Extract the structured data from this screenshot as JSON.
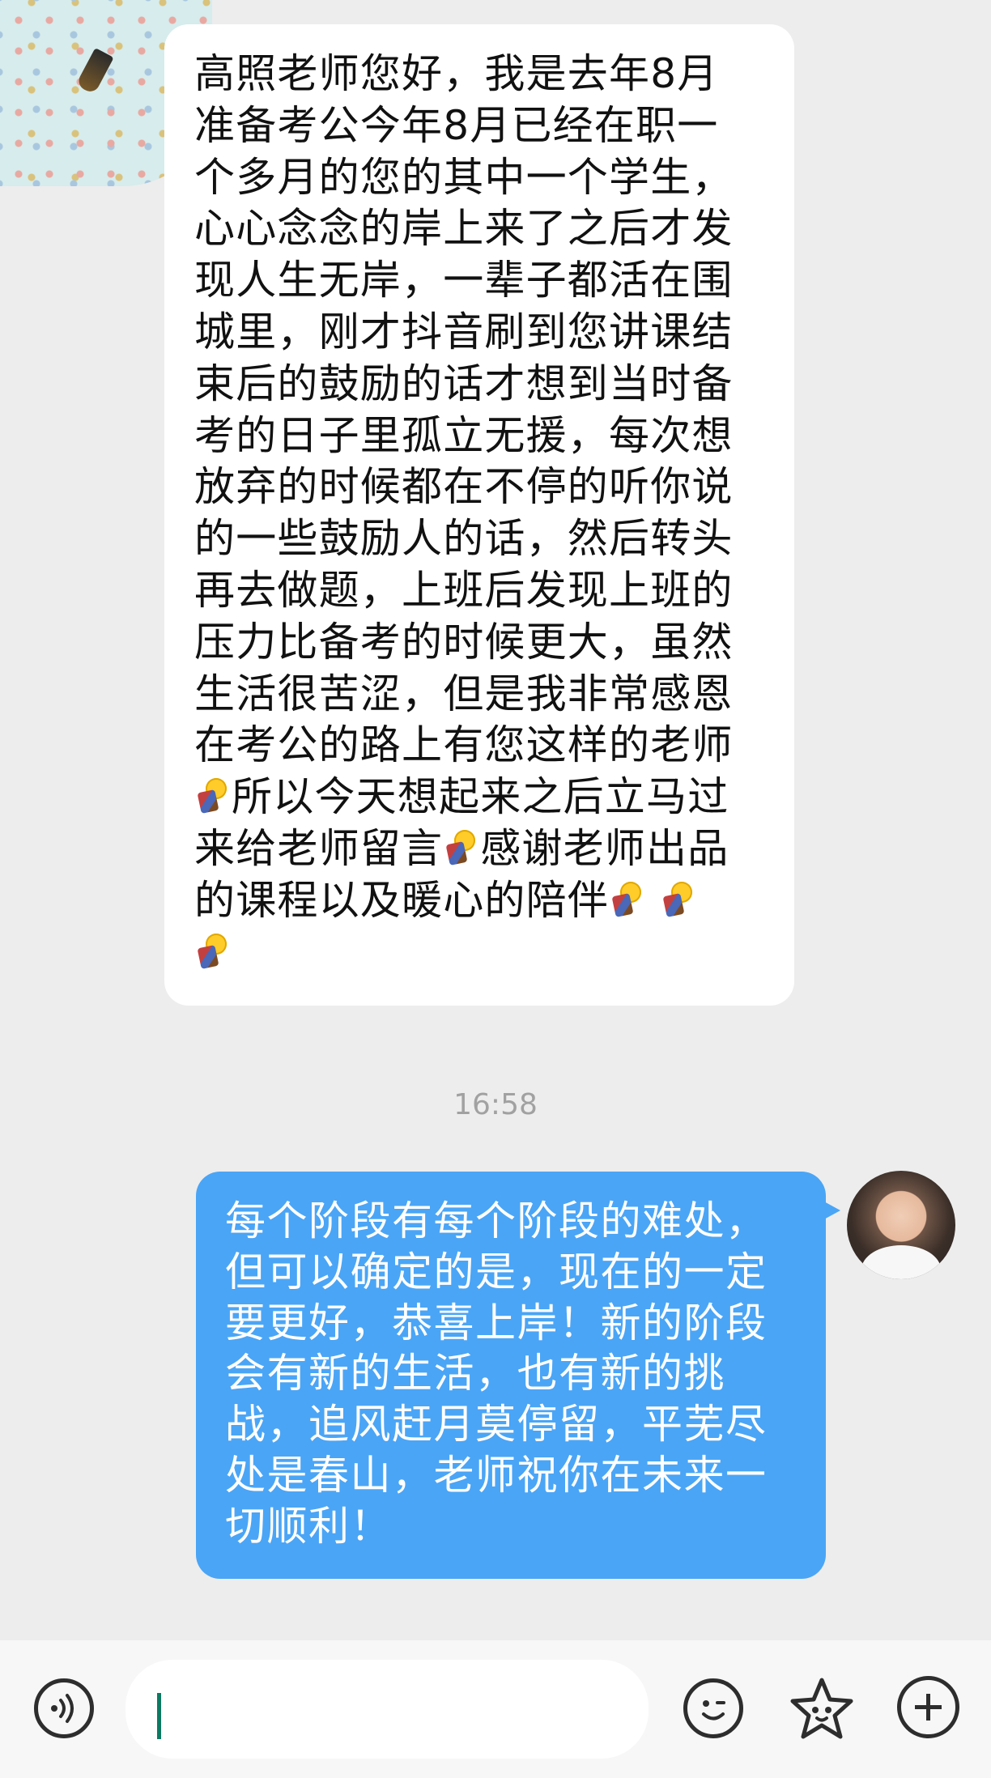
{
  "chat": {
    "incoming_message": {
      "lines": [
        "高照老师您好，我是去年8月",
        "准备考公今年8月已经在职一",
        "个多月的您的其中一个学生，",
        "心心念念的岸上来了之后才发",
        "现人生无岸，一辈子都活在围",
        "城里，刚才抖音刷到您讲课结",
        "束后的鼓励的话才想到当时备",
        "考的日子里孤立无援，每次想",
        "放弃的时候都在不停的听你说",
        "的一些鼓励人的话，然后转头",
        "再去做题，上班后发现上班的",
        "压力比备考的时候更大，虽然",
        "生活很苦涩，但是我非常感恩",
        "在考公的路上有您这样的老师"
      ],
      "line15_text": "所以今天想起来之后立马过",
      "line16_text_a": "来给老师留言",
      "line16_text_b": "感谢老师出品",
      "line17_text": "的课程以及暖心的陪伴",
      "emoji_name": "lightbulb-sticker-icon"
    },
    "timestamp": "16:58",
    "outgoing_message": {
      "lines": [
        "每个阶段有每个阶段的难处，",
        "但可以确定的是，现在的一定",
        "要更好，恭喜上岸！新的阶段",
        "会有新的生活，也有新的挑",
        "战，追风赶月莫停留，平芜尽",
        "处是春山，老师祝你在未来一",
        "切顺利！"
      ]
    }
  },
  "input_bar": {
    "voice_icon": "voice-wave-icon",
    "emoji_icon": "smiley-icon",
    "sticker_icon": "star-sticker-icon",
    "plus_icon": "plus-icon",
    "text_value": ""
  },
  "colors": {
    "background": "#ededed",
    "incoming_bubble": "#ffffff",
    "outgoing_bubble": "#4aa5f6",
    "caret": "#0b7a62"
  }
}
